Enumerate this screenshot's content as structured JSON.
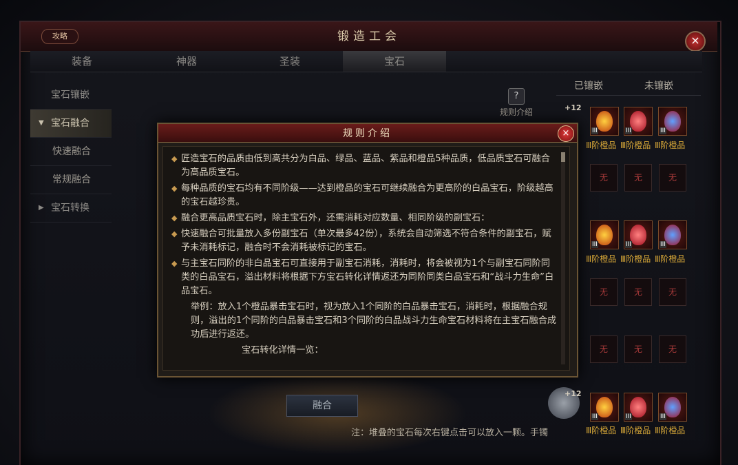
{
  "window": {
    "title": "锻造工会",
    "guide_label": "攻略",
    "close_icon": "×"
  },
  "tabs": [
    {
      "label": "装备"
    },
    {
      "label": "神器"
    },
    {
      "label": "圣装"
    },
    {
      "label": "宝石"
    }
  ],
  "sidebar": {
    "items": [
      {
        "label": "宝石镶嵌"
      },
      {
        "label": "宝石融合",
        "arrow": "▼"
      },
      {
        "label": "快速融合"
      },
      {
        "label": "常规融合"
      },
      {
        "label": "宝石转换",
        "arrow": "▶"
      }
    ]
  },
  "rule_intro": {
    "icon": "?",
    "label": "规则介绍"
  },
  "right_panel": {
    "tab_inlaid": "已镶嵌",
    "tab_not_inlaid": "未镶嵌",
    "plus_label": "+12",
    "gem_level": "III",
    "gem_label": "Ⅲ阶橙品",
    "gem_label_bottom": "Ⅲ阶橙品",
    "empty_label": "无"
  },
  "bottom": {
    "fuse_button": "融合",
    "note": "注：堆叠的宝石每次右键点击可以放入一颗。手镯",
    "bracelet_plus": "+12"
  },
  "dialog": {
    "title": "规则介绍",
    "close": "×",
    "bullet": "◆",
    "p1": "匠造宝石的品质由低到高共分为白品、绿品、蓝品、紫品和橙品5种品质，低品质宝石可融合为高品质宝石。",
    "p2": "每种品质的宝石均有不同阶级——达到橙品的宝石可继续融合为更高阶的白品宝石，阶级越高的宝石越珍贵。",
    "p3": "融合更高品质宝石时，除主宝石外，还需消耗对应数量、相同阶级的副宝石：",
    "p4": "快速融合可批量放入多份副宝石（单次最多42份），系统会自动筛选不符合条件的副宝石，赋予未消耗标记，融合时不会消耗被标记的宝石。",
    "p5": "与主宝石同阶的非白品宝石可直接用于副宝石消耗，消耗时，将会被视为1个与副宝石同阶同类的白品宝石，溢出材料将根据下方宝石转化详情返还为同阶同类白品宝石和“战斗力生命”白品宝石。",
    "example": "举例：放入1个橙品暴击宝石时，视为放入1个同阶的白品暴击宝石，消耗时，根据融合规则，溢出的1个同阶的白品暴击宝石和3个同阶的白品战斗力生命宝石材料将在主宝石融合成功后进行返还。",
    "table_title": "宝石转化详情一览："
  }
}
